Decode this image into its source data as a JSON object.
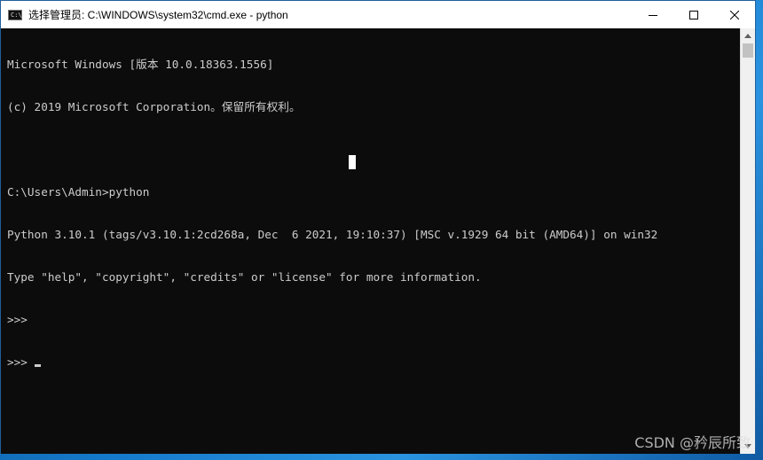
{
  "window": {
    "title": "选择管理员: C:\\WINDOWS\\system32\\cmd.exe - python",
    "icon": "cmd-icon",
    "icon_text": "C:\\",
    "controls": {
      "minimize": "minimize-icon",
      "maximize": "maximize-icon",
      "close": "close-icon"
    }
  },
  "console": {
    "lines": [
      "Microsoft Windows [版本 10.0.18363.1556]",
      "(c) 2019 Microsoft Corporation。保留所有权利。",
      "",
      "C:\\Users\\Admin>python",
      "Python 3.10.1 (tags/v3.10.1:2cd268a, Dec  6 2021, 19:10:37) [MSC v.1929 64 bit (AMD64)] on win32",
      "Type \"help\", \"copyright\", \"credits\" or \"license\" for more information.",
      ">>>",
      ">>> "
    ],
    "text_color": "#cccccc",
    "background": "#0c0c0c"
  },
  "watermark": "CSDN @矜辰所致"
}
